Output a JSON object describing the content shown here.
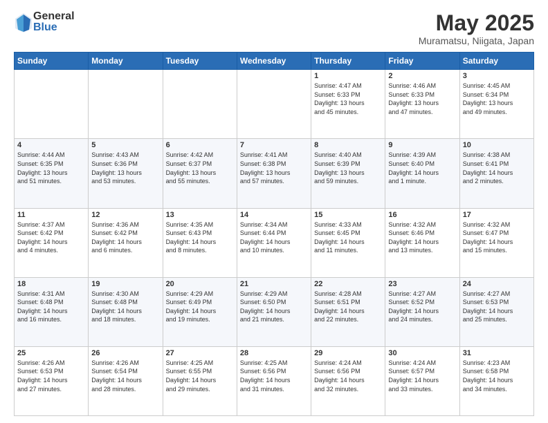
{
  "logo": {
    "general": "General",
    "blue": "Blue"
  },
  "header": {
    "month": "May 2025",
    "location": "Muramatsu, Niigata, Japan"
  },
  "weekdays": [
    "Sunday",
    "Monday",
    "Tuesday",
    "Wednesday",
    "Thursday",
    "Friday",
    "Saturday"
  ],
  "weeks": [
    [
      {
        "day": "",
        "info": ""
      },
      {
        "day": "",
        "info": ""
      },
      {
        "day": "",
        "info": ""
      },
      {
        "day": "",
        "info": ""
      },
      {
        "day": "1",
        "info": "Sunrise: 4:47 AM\nSunset: 6:33 PM\nDaylight: 13 hours\nand 45 minutes."
      },
      {
        "day": "2",
        "info": "Sunrise: 4:46 AM\nSunset: 6:33 PM\nDaylight: 13 hours\nand 47 minutes."
      },
      {
        "day": "3",
        "info": "Sunrise: 4:45 AM\nSunset: 6:34 PM\nDaylight: 13 hours\nand 49 minutes."
      }
    ],
    [
      {
        "day": "4",
        "info": "Sunrise: 4:44 AM\nSunset: 6:35 PM\nDaylight: 13 hours\nand 51 minutes."
      },
      {
        "day": "5",
        "info": "Sunrise: 4:43 AM\nSunset: 6:36 PM\nDaylight: 13 hours\nand 53 minutes."
      },
      {
        "day": "6",
        "info": "Sunrise: 4:42 AM\nSunset: 6:37 PM\nDaylight: 13 hours\nand 55 minutes."
      },
      {
        "day": "7",
        "info": "Sunrise: 4:41 AM\nSunset: 6:38 PM\nDaylight: 13 hours\nand 57 minutes."
      },
      {
        "day": "8",
        "info": "Sunrise: 4:40 AM\nSunset: 6:39 PM\nDaylight: 13 hours\nand 59 minutes."
      },
      {
        "day": "9",
        "info": "Sunrise: 4:39 AM\nSunset: 6:40 PM\nDaylight: 14 hours\nand 1 minute."
      },
      {
        "day": "10",
        "info": "Sunrise: 4:38 AM\nSunset: 6:41 PM\nDaylight: 14 hours\nand 2 minutes."
      }
    ],
    [
      {
        "day": "11",
        "info": "Sunrise: 4:37 AM\nSunset: 6:42 PM\nDaylight: 14 hours\nand 4 minutes."
      },
      {
        "day": "12",
        "info": "Sunrise: 4:36 AM\nSunset: 6:42 PM\nDaylight: 14 hours\nand 6 minutes."
      },
      {
        "day": "13",
        "info": "Sunrise: 4:35 AM\nSunset: 6:43 PM\nDaylight: 14 hours\nand 8 minutes."
      },
      {
        "day": "14",
        "info": "Sunrise: 4:34 AM\nSunset: 6:44 PM\nDaylight: 14 hours\nand 10 minutes."
      },
      {
        "day": "15",
        "info": "Sunrise: 4:33 AM\nSunset: 6:45 PM\nDaylight: 14 hours\nand 11 minutes."
      },
      {
        "day": "16",
        "info": "Sunrise: 4:32 AM\nSunset: 6:46 PM\nDaylight: 14 hours\nand 13 minutes."
      },
      {
        "day": "17",
        "info": "Sunrise: 4:32 AM\nSunset: 6:47 PM\nDaylight: 14 hours\nand 15 minutes."
      }
    ],
    [
      {
        "day": "18",
        "info": "Sunrise: 4:31 AM\nSunset: 6:48 PM\nDaylight: 14 hours\nand 16 minutes."
      },
      {
        "day": "19",
        "info": "Sunrise: 4:30 AM\nSunset: 6:48 PM\nDaylight: 14 hours\nand 18 minutes."
      },
      {
        "day": "20",
        "info": "Sunrise: 4:29 AM\nSunset: 6:49 PM\nDaylight: 14 hours\nand 19 minutes."
      },
      {
        "day": "21",
        "info": "Sunrise: 4:29 AM\nSunset: 6:50 PM\nDaylight: 14 hours\nand 21 minutes."
      },
      {
        "day": "22",
        "info": "Sunrise: 4:28 AM\nSunset: 6:51 PM\nDaylight: 14 hours\nand 22 minutes."
      },
      {
        "day": "23",
        "info": "Sunrise: 4:27 AM\nSunset: 6:52 PM\nDaylight: 14 hours\nand 24 minutes."
      },
      {
        "day": "24",
        "info": "Sunrise: 4:27 AM\nSunset: 6:53 PM\nDaylight: 14 hours\nand 25 minutes."
      }
    ],
    [
      {
        "day": "25",
        "info": "Sunrise: 4:26 AM\nSunset: 6:53 PM\nDaylight: 14 hours\nand 27 minutes."
      },
      {
        "day": "26",
        "info": "Sunrise: 4:26 AM\nSunset: 6:54 PM\nDaylight: 14 hours\nand 28 minutes."
      },
      {
        "day": "27",
        "info": "Sunrise: 4:25 AM\nSunset: 6:55 PM\nDaylight: 14 hours\nand 29 minutes."
      },
      {
        "day": "28",
        "info": "Sunrise: 4:25 AM\nSunset: 6:56 PM\nDaylight: 14 hours\nand 31 minutes."
      },
      {
        "day": "29",
        "info": "Sunrise: 4:24 AM\nSunset: 6:56 PM\nDaylight: 14 hours\nand 32 minutes."
      },
      {
        "day": "30",
        "info": "Sunrise: 4:24 AM\nSunset: 6:57 PM\nDaylight: 14 hours\nand 33 minutes."
      },
      {
        "day": "31",
        "info": "Sunrise: 4:23 AM\nSunset: 6:58 PM\nDaylight: 14 hours\nand 34 minutes."
      }
    ]
  ]
}
